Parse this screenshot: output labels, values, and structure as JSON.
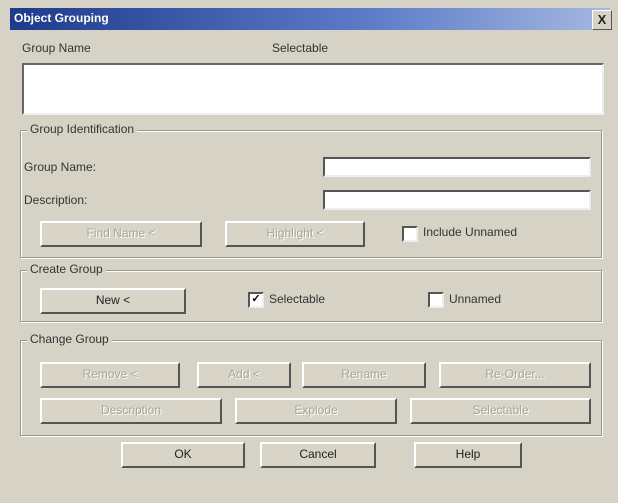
{
  "window": {
    "title": "Object Grouping",
    "close_glyph": "X"
  },
  "list": {
    "col_group_name": "Group Name",
    "col_selectable": "Selectable"
  },
  "identification": {
    "legend": "Group Identification",
    "group_name_label": "Group Name:",
    "group_name_value": "",
    "description_label": "Description:",
    "description_value": "",
    "find_name_button": "Find Name <",
    "highlight_button": "Highlight <",
    "include_unnamed_label": "Include Unnamed",
    "include_unnamed_checked": false
  },
  "create": {
    "legend": "Create Group",
    "new_button": "New <",
    "selectable_label": "Selectable",
    "selectable_checked": true,
    "selectable_glyph": "✓",
    "unnamed_label": "Unnamed",
    "unnamed_checked": false
  },
  "change": {
    "legend": "Change Group",
    "remove_button": "Remove <",
    "add_button": "Add <",
    "rename_button": "Rename",
    "reorder_button": "Re-Order...",
    "description_button": "Description",
    "explode_button": "Explode",
    "selectable_button": "Selectable"
  },
  "footer": {
    "ok_button": "OK",
    "cancel_button": "Cancel",
    "help_button": "Help"
  }
}
